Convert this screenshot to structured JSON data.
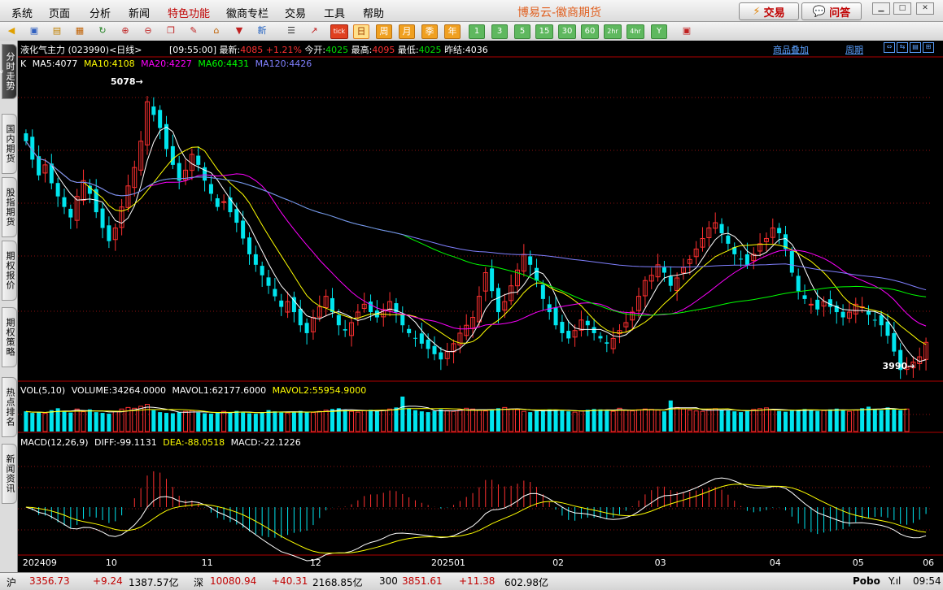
{
  "menu": [
    "系统",
    "页面",
    "分析",
    "新闻",
    "特色功能",
    "徽商专栏",
    "交易",
    "工具",
    "帮助"
  ],
  "app_title": "博易云-徽商期货",
  "top_buttons": {
    "trade": "交易",
    "qa": "问答"
  },
  "toolbar": {
    "tick": "tick",
    "day": "日",
    "week": "周",
    "month": "月",
    "season": "季",
    "year": "年",
    "periods": [
      "1",
      "3",
      "5",
      "15",
      "30",
      "60",
      "2hr",
      "4hr",
      "Y"
    ],
    "new_label": "新"
  },
  "sidebar": [
    "分时走势",
    "国内期货",
    "股指期货",
    "期权报价",
    "期权策略",
    "热点排名",
    "新闻资讯"
  ],
  "sidebar_num": "3",
  "info": {
    "symbol": "液化气主力 (023990)",
    "period": "<日线>",
    "time": "[09:55:00]",
    "latest_label": "最新:",
    "latest": "4085",
    "change": "+1.21%",
    "open_label": "今开:",
    "open": "4025",
    "high_label": "最高:",
    "high": "4095",
    "low_label": "最低:",
    "low": "4025",
    "prev_label": "昨结:",
    "prev": "4036",
    "overlay": "商品叠加",
    "cycle": "周期"
  },
  "ma_header": {
    "k": "K",
    "ma5": "MA5:4077",
    "ma10": "MA10:4108",
    "ma20": "MA20:4227",
    "ma60": "MA60:4431",
    "ma120": "MA120:4426"
  },
  "vol_header": {
    "vol": "VOL(5,10)",
    "volume": "VOLUME:34264.0000",
    "mavol1": "MAVOL1:62177.6000",
    "mavol2": "MAVOL2:55954.9000"
  },
  "macd_header": {
    "macd": "MACD(12,26,9)",
    "diff": "DIFF:-99.1131",
    "dea": "DEA:-88.0518",
    "val": "MACD:-22.1226"
  },
  "colors": {
    "up": "#ff3030",
    "down": "#00e5ee",
    "ma5": "#ffffff",
    "ma10": "#ffff00",
    "ma20": "#ff00ff",
    "ma60": "#00ff00",
    "ma120": "#8080ff"
  },
  "chart_data": {
    "type": "candlestick",
    "high_mark": "5078",
    "low_mark": "3990",
    "x_labels": [
      "202409",
      "10",
      "11",
      "12",
      "202501",
      "02",
      "03",
      "04",
      "05",
      "06"
    ],
    "closes": [
      4850,
      4780,
      4720,
      4760,
      4690,
      4640,
      4600,
      4560,
      4640,
      4700,
      4650,
      4580,
      4520,
      4470,
      4520,
      4600,
      4680,
      4750,
      4850,
      5000,
      4950,
      4900,
      4820,
      4760,
      4700,
      4740,
      4800,
      4760,
      4700,
      4650,
      4600,
      4620,
      4580,
      4540,
      4480,
      4420,
      4380,
      4340,
      4300,
      4260,
      4220,
      4240,
      4200,
      4150,
      4120,
      4180,
      4220,
      4260,
      4200,
      4150,
      4130,
      4160,
      4200,
      4230,
      4200,
      4180,
      4210,
      4240,
      4200,
      4150,
      4120,
      4100,
      4080,
      4060,
      4040,
      4020,
      4050,
      4080,
      4120,
      4150,
      4180,
      4260,
      4350,
      4280,
      4200,
      4240,
      4300,
      4360,
      4420,
      4380,
      4320,
      4250,
      4200,
      4150,
      4120,
      4100,
      4130,
      4170,
      4150,
      4120,
      4100,
      4080,
      4100,
      4130,
      4160,
      4200,
      4260,
      4320,
      4340,
      4380,
      4350,
      4300,
      4330,
      4370,
      4400,
      4440,
      4480,
      4520,
      4540,
      4500,
      4460,
      4420,
      4400,
      4380,
      4420,
      4460,
      4480,
      4520,
      4500,
      4440,
      4350,
      4280,
      4250,
      4230,
      4210,
      4240,
      4220,
      4200,
      4180,
      4200,
      4230,
      4220,
      4190,
      4170,
      4150,
      4110,
      4050,
      3980,
      3990,
      4010,
      4030,
      4085
    ],
    "volumes": [
      52,
      48,
      50,
      47,
      55,
      60,
      53,
      49,
      58,
      51,
      57,
      50,
      48,
      46,
      52,
      58,
      62,
      60,
      65,
      70,
      55,
      50,
      48,
      47,
      50,
      52,
      54,
      49,
      47,
      46,
      48,
      52,
      50,
      53,
      49,
      47,
      46,
      50,
      55,
      52,
      49,
      48,
      51,
      53,
      50,
      49,
      52,
      55,
      58,
      60,
      56,
      52,
      50,
      54,
      56,
      53,
      55,
      58,
      62,
      90,
      60,
      55,
      52,
      50,
      53,
      57,
      54,
      52,
      56,
      60,
      58,
      55,
      53,
      57,
      60,
      62,
      58,
      56,
      52,
      50,
      53,
      55,
      57,
      56,
      54,
      52,
      50,
      53,
      56,
      58,
      57,
      54,
      52,
      60,
      55,
      53,
      56,
      58,
      57,
      55,
      52,
      80,
      62,
      58,
      55,
      53,
      52,
      57,
      59,
      56,
      54,
      52,
      50,
      55,
      57,
      59,
      61,
      56,
      53,
      51,
      54,
      56,
      58,
      55,
      53,
      54,
      57,
      59,
      56,
      52,
      55,
      60,
      64,
      58,
      55,
      62,
      57,
      55,
      58
    ]
  },
  "status": {
    "sh_label": "沪",
    "sh_val": "3356.73",
    "sh_chg": "+9.24",
    "sh_amt": "1387.57亿",
    "sz_label": "深",
    "sz_val": "10080.94",
    "sz_chg": "+40.31",
    "sz_amt": "2168.85亿",
    "c300_label": "300",
    "c300_val": "3851.61",
    "c300_chg": "+11.38",
    "c300_amt": "602.98亿",
    "brand": "Pobo",
    "clock": "09:54"
  }
}
